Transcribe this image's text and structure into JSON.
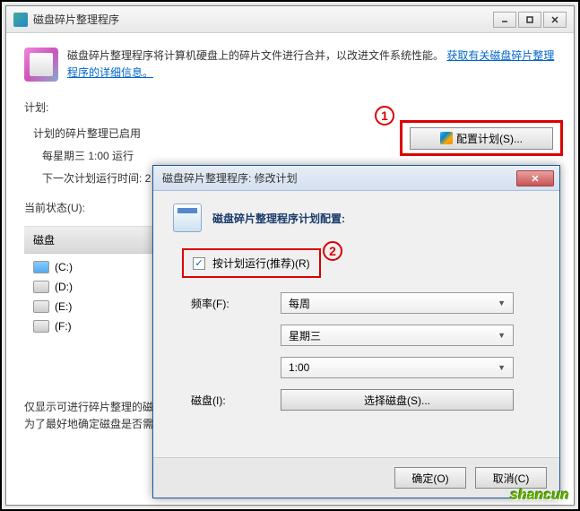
{
  "main_window": {
    "title": "磁盘碎片整理程序",
    "info_text": "磁盘碎片整理程序将计算机硬盘上的碎片文件进行合并，以改进文件系统性能。",
    "info_link": "获取有关磁盘碎片整理程序的详细信息。",
    "schedule_label": "计划:",
    "schedule_enabled": "计划的碎片整理已启用",
    "schedule_time": "每星期三  1:00 运行",
    "next_run": "下一次计划运行时间: 2",
    "config_button": "配置计划(S)...",
    "status_label": "当前状态(U):",
    "disk_header": "磁盘",
    "disks": [
      {
        "label": "(C:)",
        "type": "c"
      },
      {
        "label": "(D:)",
        "type": "d"
      },
      {
        "label": "(E:)",
        "type": "d"
      },
      {
        "label": "(F:)",
        "type": "d"
      }
    ],
    "bottom_note1": "仅显示可进行碎片整理的磁",
    "bottom_note2": "为了最好地确定磁盘是否需"
  },
  "annotations": {
    "one": "1",
    "two": "2"
  },
  "dialog": {
    "title": "磁盘碎片整理程序: 修改计划",
    "heading": "磁盘碎片整理程序计划配置:",
    "checkbox_label": "按计划运行(推荐)(R)",
    "freq_label": "频率(F):",
    "freq_value": "每周",
    "day_value": "星期三",
    "time_value": "1:00",
    "disk_label": "磁盘(I):",
    "disk_button": "选择磁盘(S)...",
    "ok": "确定(O)",
    "cancel": "取消(C)"
  },
  "watermark": "shancun"
}
